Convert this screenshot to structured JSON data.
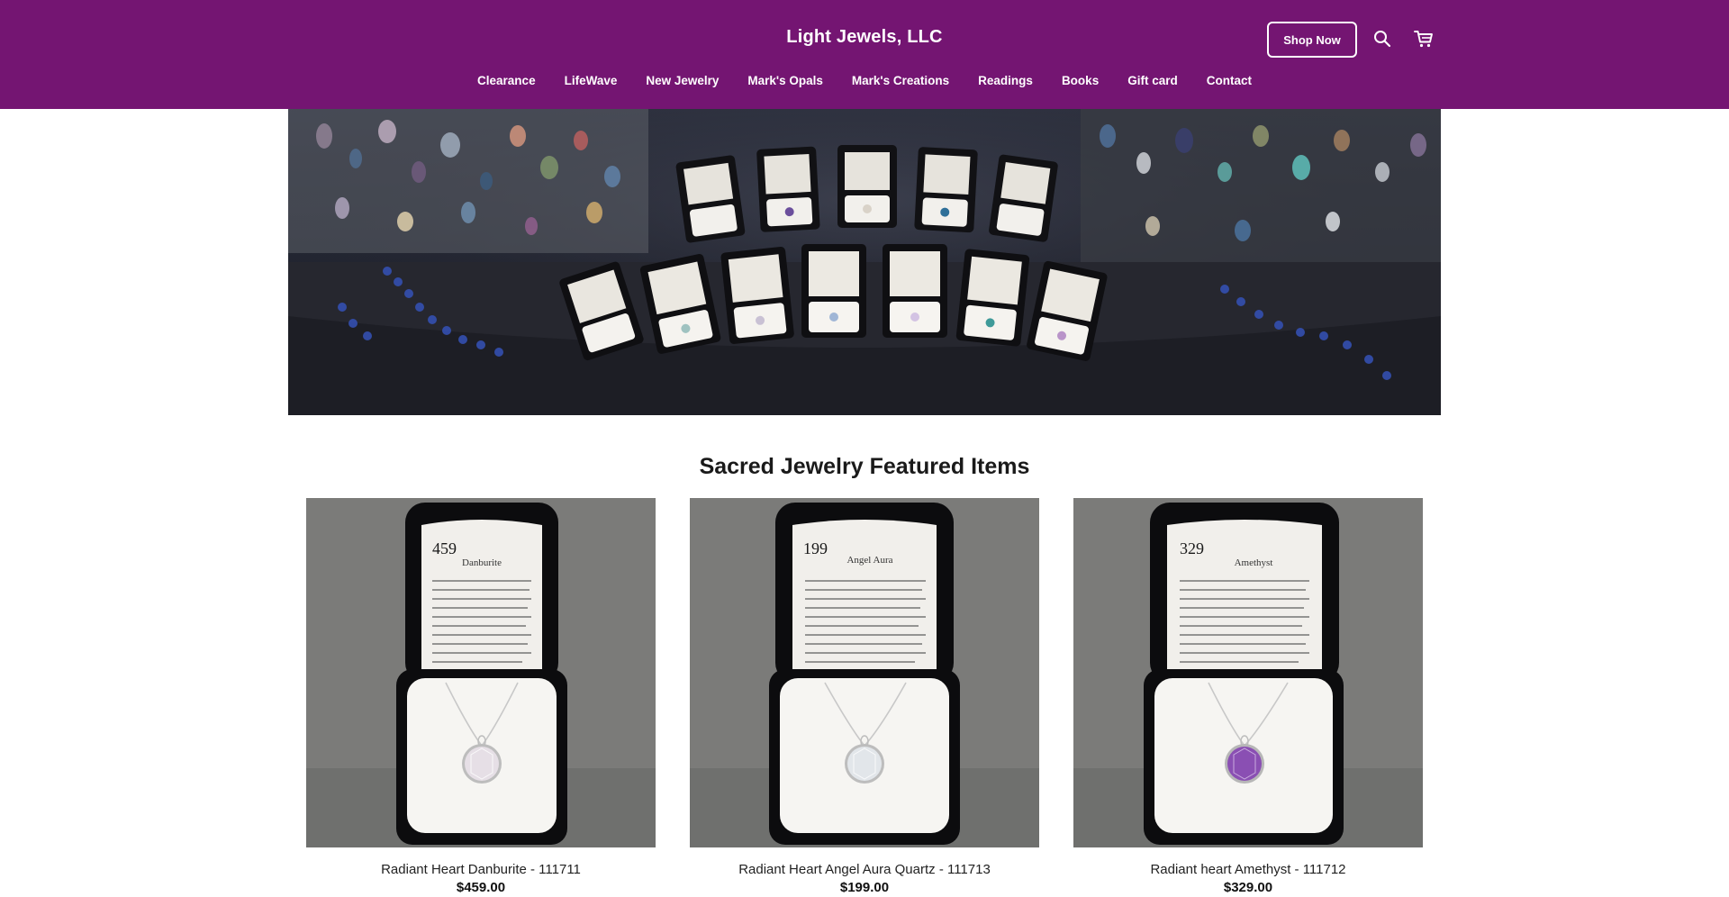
{
  "header": {
    "brand": "Light Jewels, LLC",
    "shop_now_label": "Shop Now",
    "background_color": "#741572",
    "icons": [
      "search-icon",
      "cart-icon"
    ]
  },
  "nav": {
    "items": [
      {
        "label": "Clearance"
      },
      {
        "label": "LifeWave"
      },
      {
        "label": "New Jewelry"
      },
      {
        "label": "Mark's Opals"
      },
      {
        "label": "Mark's Creations"
      },
      {
        "label": "Readings"
      },
      {
        "label": "Books"
      },
      {
        "label": "Gift card"
      },
      {
        "label": "Contact"
      }
    ]
  },
  "featured": {
    "title": "Sacred Jewelry Featured Items",
    "products": [
      {
        "name": "Radiant Heart Danburite - 111711",
        "price": "$459.00",
        "card_tag": "459",
        "card_heading": "Danburite",
        "gem_color": "#e6dfe6"
      },
      {
        "name": "Radiant Heart Angel Aura Quartz - 111713",
        "price": "$199.00",
        "card_tag": "199",
        "card_heading": "Angel Aura",
        "gem_color": "#e2e6ea"
      },
      {
        "name": "Radiant heart Amethyst - 111712",
        "price": "$329.00",
        "card_tag": "329",
        "card_heading": "Amethyst",
        "gem_color": "#8a4fb3"
      }
    ]
  }
}
